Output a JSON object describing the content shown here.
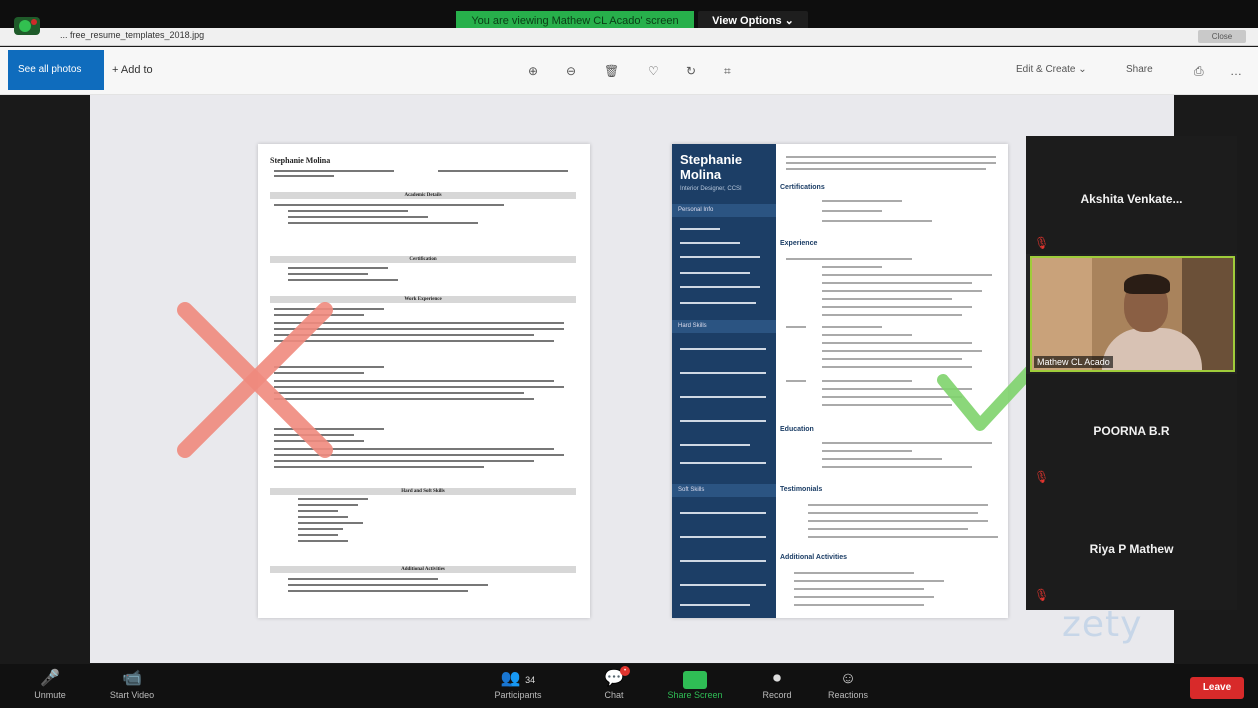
{
  "meeting_bar": {
    "share_banner": "You are viewing Mathew CL Acado' screen",
    "view_options": "View Options ⌄"
  },
  "window": {
    "title": "... free_resume_templates_2018.jpg",
    "close_label": "Close"
  },
  "photos_toolbar": {
    "see_all": "See all photos",
    "add_to": "+ Add to",
    "edit_create": "Edit & Create ⌄",
    "share": "Share"
  },
  "resume_left": {
    "name": "Stephanie Molina",
    "sections": [
      "Academic Details",
      "Certification",
      "Work Experience",
      "Hard and Soft Skills",
      "Additional Activities"
    ]
  },
  "resume_right": {
    "name_line1": "Stephanie",
    "name_line2": "Molina",
    "subtitle": "Interior Designer, CCSI",
    "side_sections": [
      "Personal Info",
      "Hard Skills",
      "Soft Skills"
    ],
    "main_sections": [
      "Certifications",
      "Experience",
      "Education",
      "Testimonials",
      "Additional Activities"
    ]
  },
  "watermark": "zety",
  "participants": [
    {
      "name": "Akshita Venkate..."
    },
    {
      "name": "Mathew CL Acado",
      "video": true
    },
    {
      "name": "POORNA B.R"
    },
    {
      "name": "Riya P Mathew"
    }
  ],
  "controls": {
    "unmute": "Unmute",
    "start_video": "Start Video",
    "participants": "Participants",
    "participants_count": "34",
    "chat": "Chat",
    "share_screen": "Share Screen",
    "record": "Record",
    "reactions": "Reactions",
    "leave": "Leave"
  },
  "colors": {
    "share_banner": "#27b04b",
    "leave": "#d82a2a",
    "resume_sidebar": "#1c3e66",
    "photos_accent": "#0f6cbd"
  }
}
